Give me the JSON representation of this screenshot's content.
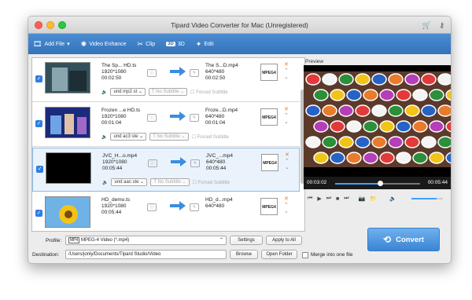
{
  "window": {
    "title": "Tipard Video Converter for Mac (Unregistered)",
    "icons": [
      "cart-icon",
      "key-icon"
    ]
  },
  "toolbar": {
    "add_file": "Add File",
    "video_enhance": "Video Enhance",
    "clip": "Clip",
    "three_d_badge": "3D",
    "three_d": "3D",
    "edit": "Edit"
  },
  "files": [
    {
      "src_name": "The Sp... HD.ts",
      "src_res": "1920*1080",
      "src_dur": "00:02:50",
      "dst_name": "The S...D.mp4",
      "dst_res": "640*480",
      "dst_dur": "00:02:50",
      "audio": "und mp2 st",
      "subtitle": "No Subtitle",
      "forced": "Forced Subtitle",
      "selected": false,
      "thumb": "street"
    },
    {
      "src_name": "Frozen ...e HD.ts",
      "src_res": "1920*1080",
      "src_dur": "00:01:04",
      "dst_name": "Froze...D.mp4",
      "dst_res": "640*480",
      "dst_dur": "00:01:04",
      "audio": "und ac3 ste",
      "subtitle": "No Subtitle",
      "forced": "Forced Subtitle",
      "selected": false,
      "thumb": "frozen"
    },
    {
      "src_name": "JVC_H...o.mp4",
      "src_res": "1920*1080",
      "src_dur": "00:05:44",
      "dst_name": "JVC_...mp4",
      "dst_res": "640*480",
      "dst_dur": "00:05:44",
      "audio": "und aac ste",
      "subtitle": "No Subtitle",
      "forced": "Forced Subtitle",
      "selected": true,
      "thumb": "black"
    },
    {
      "src_name": "HD_demo.ts",
      "src_res": "1920*1080",
      "src_dur": "00:05:44",
      "dst_name": "HD_d...mp4",
      "dst_res": "640*480",
      "dst_dur": "",
      "audio": "",
      "subtitle": "",
      "forced": "",
      "selected": false,
      "thumb": "flower"
    }
  ],
  "format_icon_label": "MPEG4",
  "preview": {
    "label": "Preview",
    "time_current": "00:03:02",
    "time_total": "00:05:44",
    "progress": 0.53,
    "volume": 0.8
  },
  "bottom": {
    "profile_label": "Profile:",
    "profile_value": "MPEG-4 Video (*.mp4)",
    "settings": "Settings",
    "apply_all": "Apply to All",
    "destination_label": "Destination:",
    "destination_value": "/Users/jonly/Documents/Tipard Studio/Video",
    "browse": "Browse",
    "open_folder": "Open Folder",
    "merge": "Merge into one file",
    "convert": "Convert"
  },
  "colors": {
    "toolbar": "#3a7cc4",
    "accent": "#3ea2ff",
    "convert": "#4a90dd"
  }
}
